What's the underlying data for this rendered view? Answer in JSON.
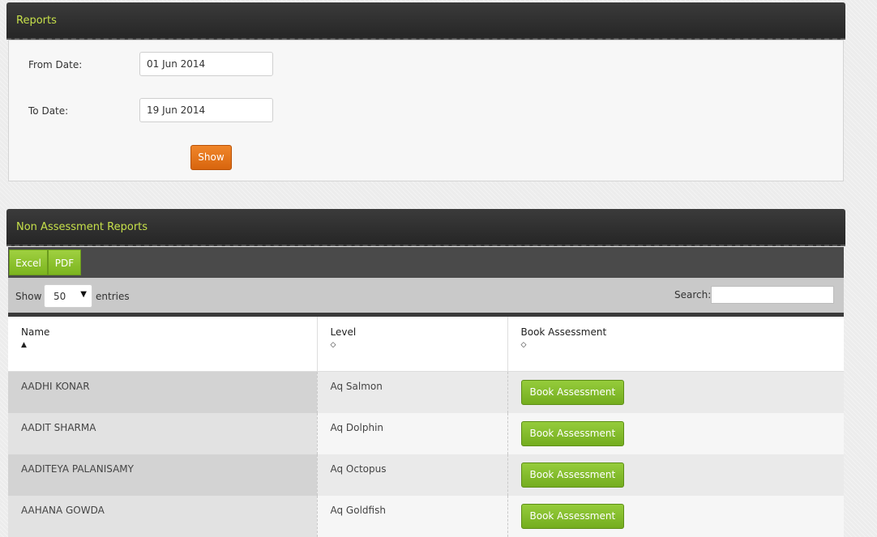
{
  "reports": {
    "title": "Reports",
    "from_label": "From Date:",
    "from_value": "01 Jun 2014",
    "to_label": "To Date:",
    "to_value": "19 Jun 2014",
    "show_label": "Show"
  },
  "non_assessment": {
    "title": "Non Assessment Reports",
    "excel_label": "Excel",
    "pdf_label": "PDF",
    "show_text": "Show",
    "entries_value": "50",
    "entries_text": "entries",
    "search_label": "Search:",
    "search_value": "",
    "columns": [
      "Name",
      "Level",
      "Book Assessment"
    ],
    "sort_icons": [
      "▲",
      "◇",
      "◇"
    ],
    "rows": [
      {
        "name": "AADHI KONAR",
        "level": "Aq Salmon",
        "action": "Book Assessment"
      },
      {
        "name": "AADIT SHARMA",
        "level": "Aq Dolphin",
        "action": "Book Assessment"
      },
      {
        "name": "AADITEYA PALANISAMY",
        "level": "Aq Octopus",
        "action": "Book Assessment"
      },
      {
        "name": "AAHANA GOWDA",
        "level": "Aq Goldfish",
        "action": "Book Assessment"
      }
    ]
  },
  "colors": {
    "header_bg": "#2e2e2e",
    "header_text": "#c6e04a",
    "show_button": "#e6761a",
    "green_button": "#86bf2c"
  }
}
